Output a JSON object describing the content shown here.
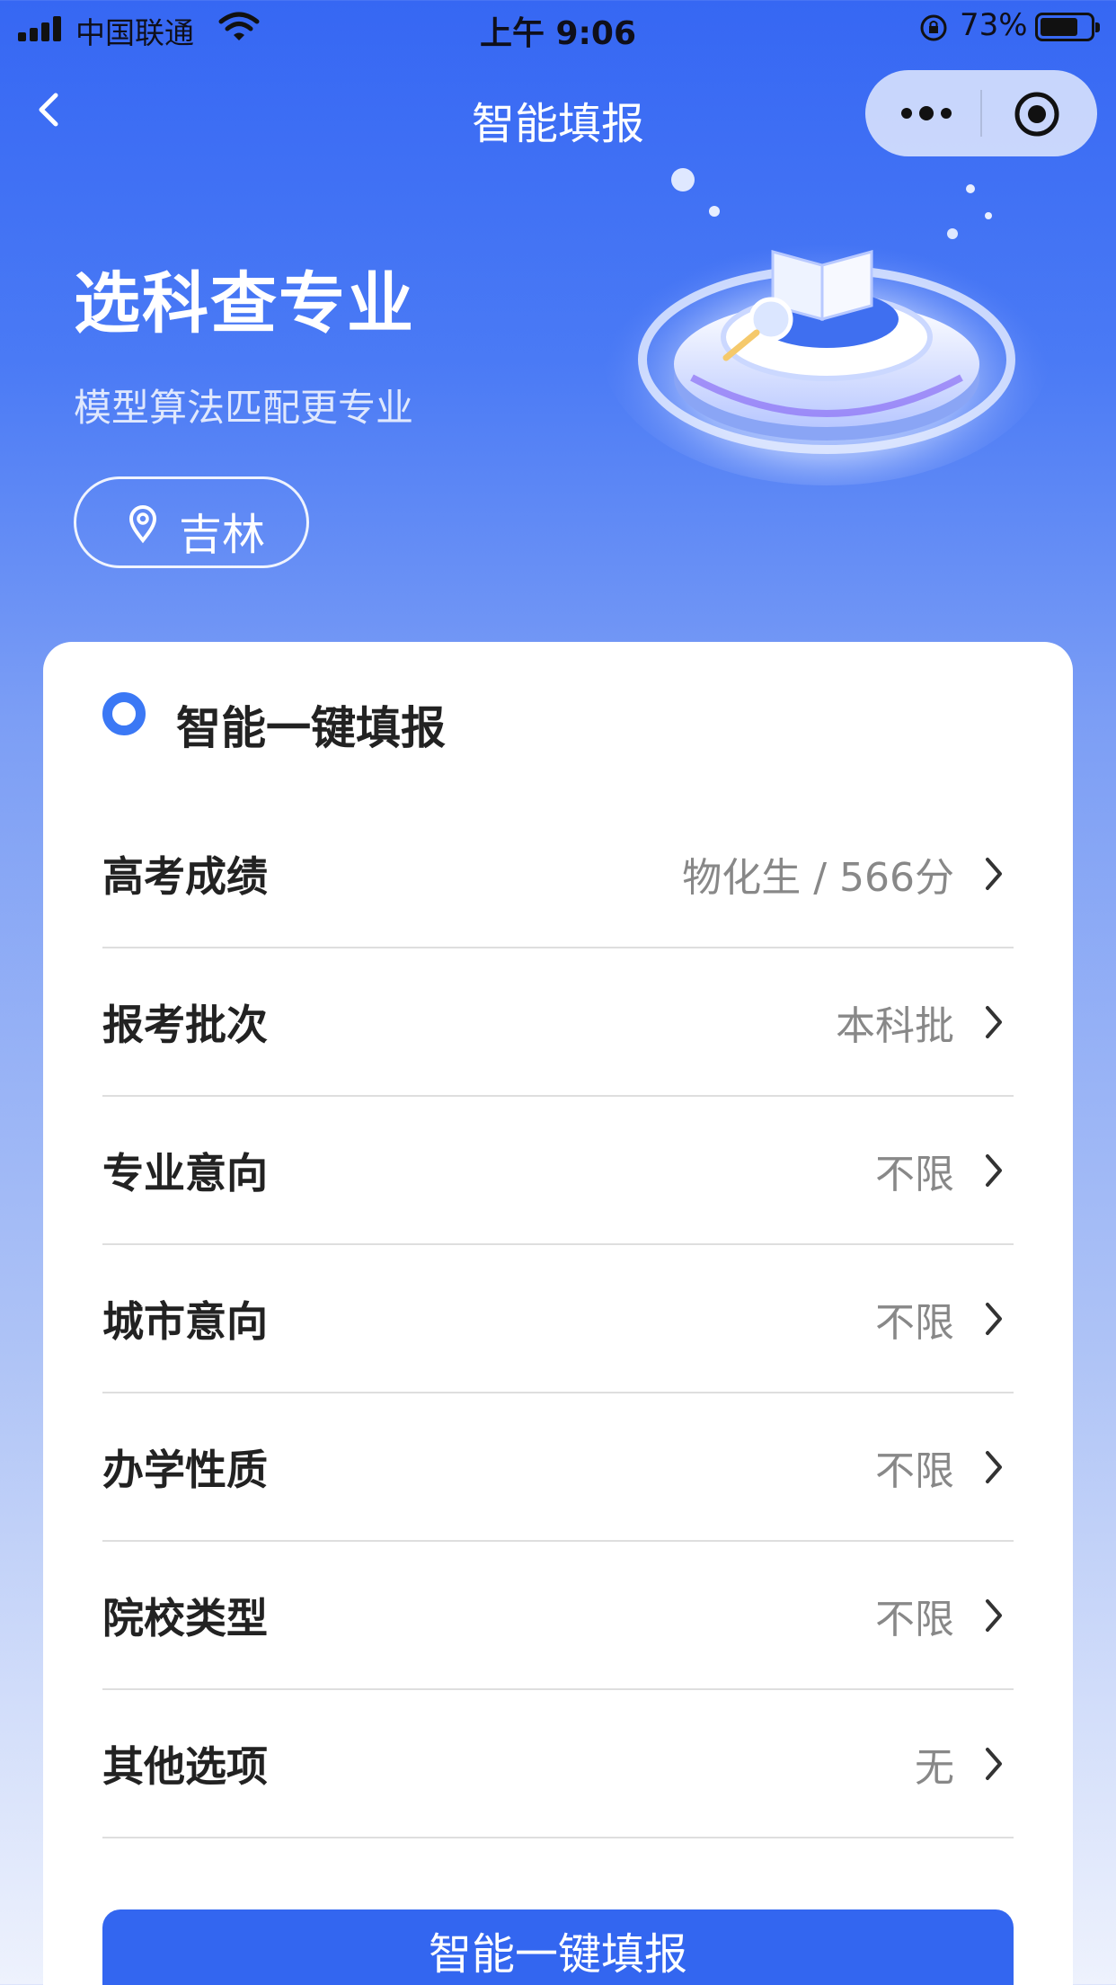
{
  "status_bar": {
    "carrier": "中国联通",
    "time": "上午 9:06",
    "battery": "73%"
  },
  "nav": {
    "title": "智能填报"
  },
  "hero": {
    "title": "选科查专业",
    "subtitle": "模型算法匹配更专业",
    "location": "吉林"
  },
  "card": {
    "title": "智能一键填报",
    "rows": [
      {
        "label": "高考成绩",
        "value": "物化生 / 566分"
      },
      {
        "label": "报考批次",
        "value": "本科批"
      },
      {
        "label": "专业意向",
        "value": "不限"
      },
      {
        "label": "城市意向",
        "value": "不限"
      },
      {
        "label": "办学性质",
        "value": "不限"
      },
      {
        "label": "院校类型",
        "value": "不限"
      },
      {
        "label": "其他选项",
        "value": "无"
      }
    ],
    "submit_label": "智能一键填报"
  },
  "colors": {
    "primary": "#3366f0",
    "header_blue": "#3667f3"
  }
}
